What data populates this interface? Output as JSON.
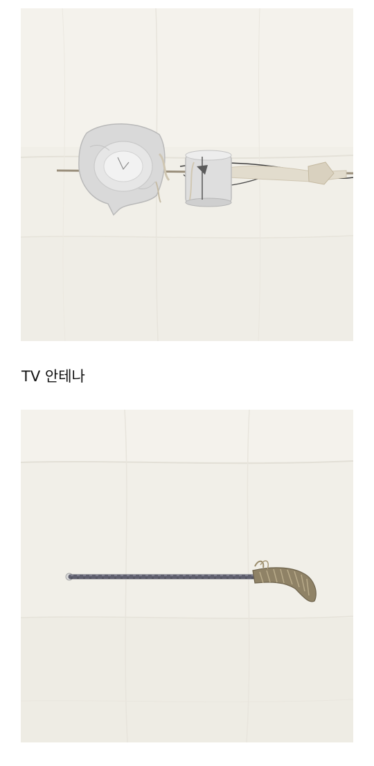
{
  "items": [
    {
      "image_alt": "TV 안테나",
      "caption": "TV 안테나"
    },
    {
      "image_alt": ""
    }
  ]
}
